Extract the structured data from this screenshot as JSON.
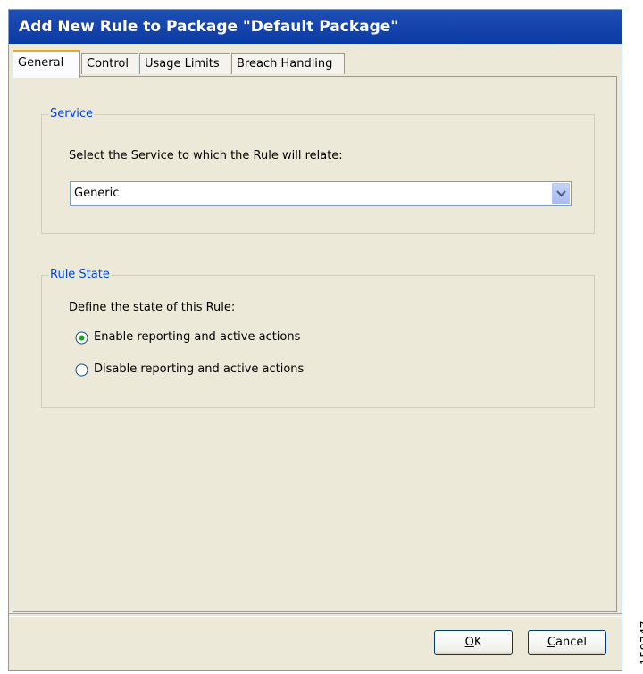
{
  "window": {
    "title": "Add New Rule to Package \"Default Package\""
  },
  "tabs": [
    {
      "label": "General",
      "active": true
    },
    {
      "label": "Control",
      "active": false
    },
    {
      "label": "Usage Limits",
      "active": false
    },
    {
      "label": "Breach Handling",
      "active": false
    }
  ],
  "service_group": {
    "legend": "Service",
    "prompt": "Select the Service to which the Rule will relate:",
    "selected_value": "Generic"
  },
  "rule_state_group": {
    "legend": "Rule State",
    "prompt": "Define the state of this Rule:",
    "options": [
      {
        "label": "Enable reporting and active actions",
        "selected": true
      },
      {
        "label": "Disable reporting and active actions",
        "selected": false
      }
    ]
  },
  "buttons": {
    "ok_label": "OK",
    "ok_mnemonic": "O",
    "ok_rest": "K",
    "cancel_label": "Cancel",
    "cancel_mnemonic": "C",
    "cancel_rest": "ancel"
  },
  "figure_id": "158747",
  "colors": {
    "titlebar": "#0a3aa3",
    "dialog_bg": "#ece9d8",
    "group_legend": "#0046d5",
    "radio_selected": "#21a121",
    "active_tab_accent": "#e6a82d"
  }
}
